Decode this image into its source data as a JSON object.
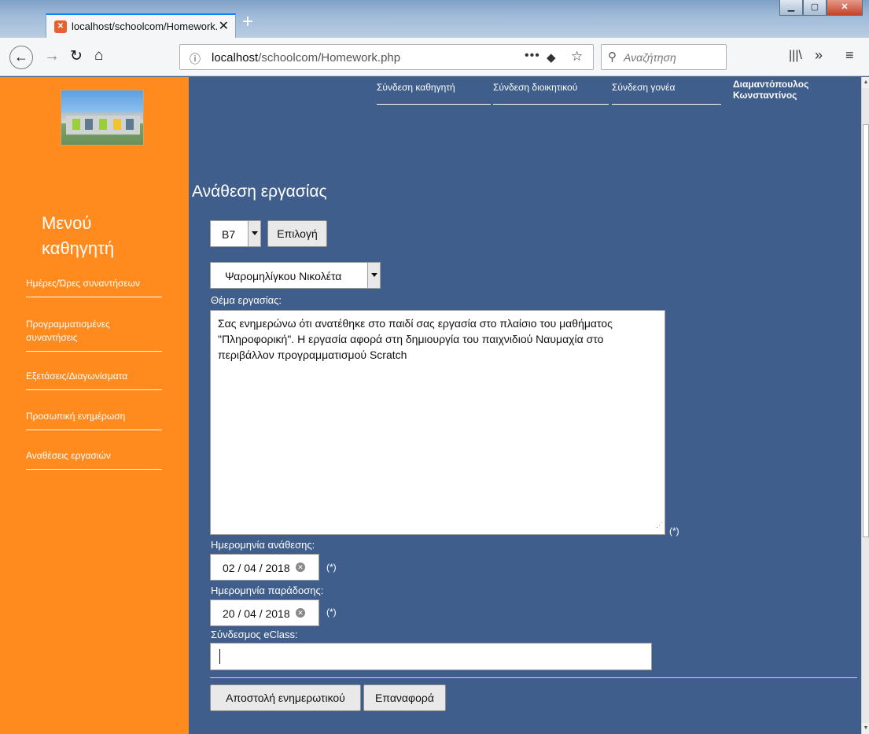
{
  "browser": {
    "tab_title": "localhost/schoolcom/Homework.php",
    "favicon": "xampp-icon",
    "url_host": "localhost",
    "url_path": "/schoolcom/Homework.php",
    "search_placeholder": "Αναζήτηση"
  },
  "header": {
    "links": [
      "Σύνδεση καθηγητή",
      "Σύνδεση διοικητικού",
      "Σύνδεση γονέα"
    ],
    "user_name_line1": "Διαμαντόπουλος",
    "user_name_line2": "Κωνσταντίνος"
  },
  "sidebar": {
    "menu_title_line1": "Μενού",
    "menu_title_line2": "καθηγητή",
    "items": [
      {
        "label": "Ημέρες/Ώρες συναντήσεων"
      },
      {
        "label": "Προγραμματισμένες συναντήσεις"
      },
      {
        "label": "Εξετάσεις/Διαγωνίσματα"
      },
      {
        "label": "Προσωπική ενημέρωση"
      },
      {
        "label": "Αναθέσεις εργασιών"
      }
    ]
  },
  "form": {
    "page_title": "Ανάθεση εργασίας",
    "class_select": "B7",
    "select_button": "Επιλογή",
    "student_select": "Ψαρομηλίγκου Νικολέτα",
    "subject_label": "Θέμα εργασίας:",
    "subject_text": "Σας ενημερώνω ότι ανατέθηκε στο παιδί σας εργασία στο πλαίσιο του μαθήματος \"Πληροφορική\". Η εργασία αφορά στη δημιουργία του παιχνιδιού Ναυμαχία στο περιβάλλον προγραμματισμού Scratch",
    "required_mark": "(*)",
    "assign_date_label": "Ημερομηνία ανάθεσης:",
    "assign_date": "02 / 04 / 2018",
    "due_date_label": "Ημερομηνία παράδοσης:",
    "due_date": "20 / 04 / 2018",
    "eclass_label": "Σύνδεσμος eClass:",
    "eclass_value": "",
    "submit_button": "Αποστολή ενημερωτικού",
    "reset_button": "Επαναφορά"
  }
}
